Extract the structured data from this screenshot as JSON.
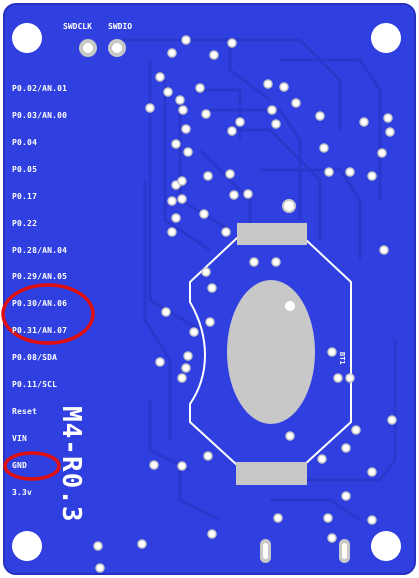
{
  "board": {
    "title": "M4-R0.3",
    "battery_ref": "BT1",
    "colors": {
      "board": "#3040e0",
      "trace": "#2a37cc",
      "pad": "#ffffff",
      "pad_gray": "#c8c8c8",
      "highlight": "#e01010",
      "silkscreen": "#ffffff"
    }
  },
  "debug_header": {
    "pins": [
      "SWDCLK",
      "SWDIO"
    ]
  },
  "pins": [
    "P0.02/AN.01",
    "P0.03/AN.00",
    "P0.04",
    "P0.05",
    "P0.17",
    "P0.22",
    "P0.28/AN.04",
    "P0.29/AN.05",
    "P0.30/AN.06",
    "P0.31/AN.07",
    "P0.08/SDA",
    "P0.11/SCL",
    "Reset",
    "VIN",
    "GND",
    "3.3v"
  ],
  "highlighted_pins": [
    "P0.30/AN.06",
    "P0.31/AN.07",
    "GND"
  ]
}
